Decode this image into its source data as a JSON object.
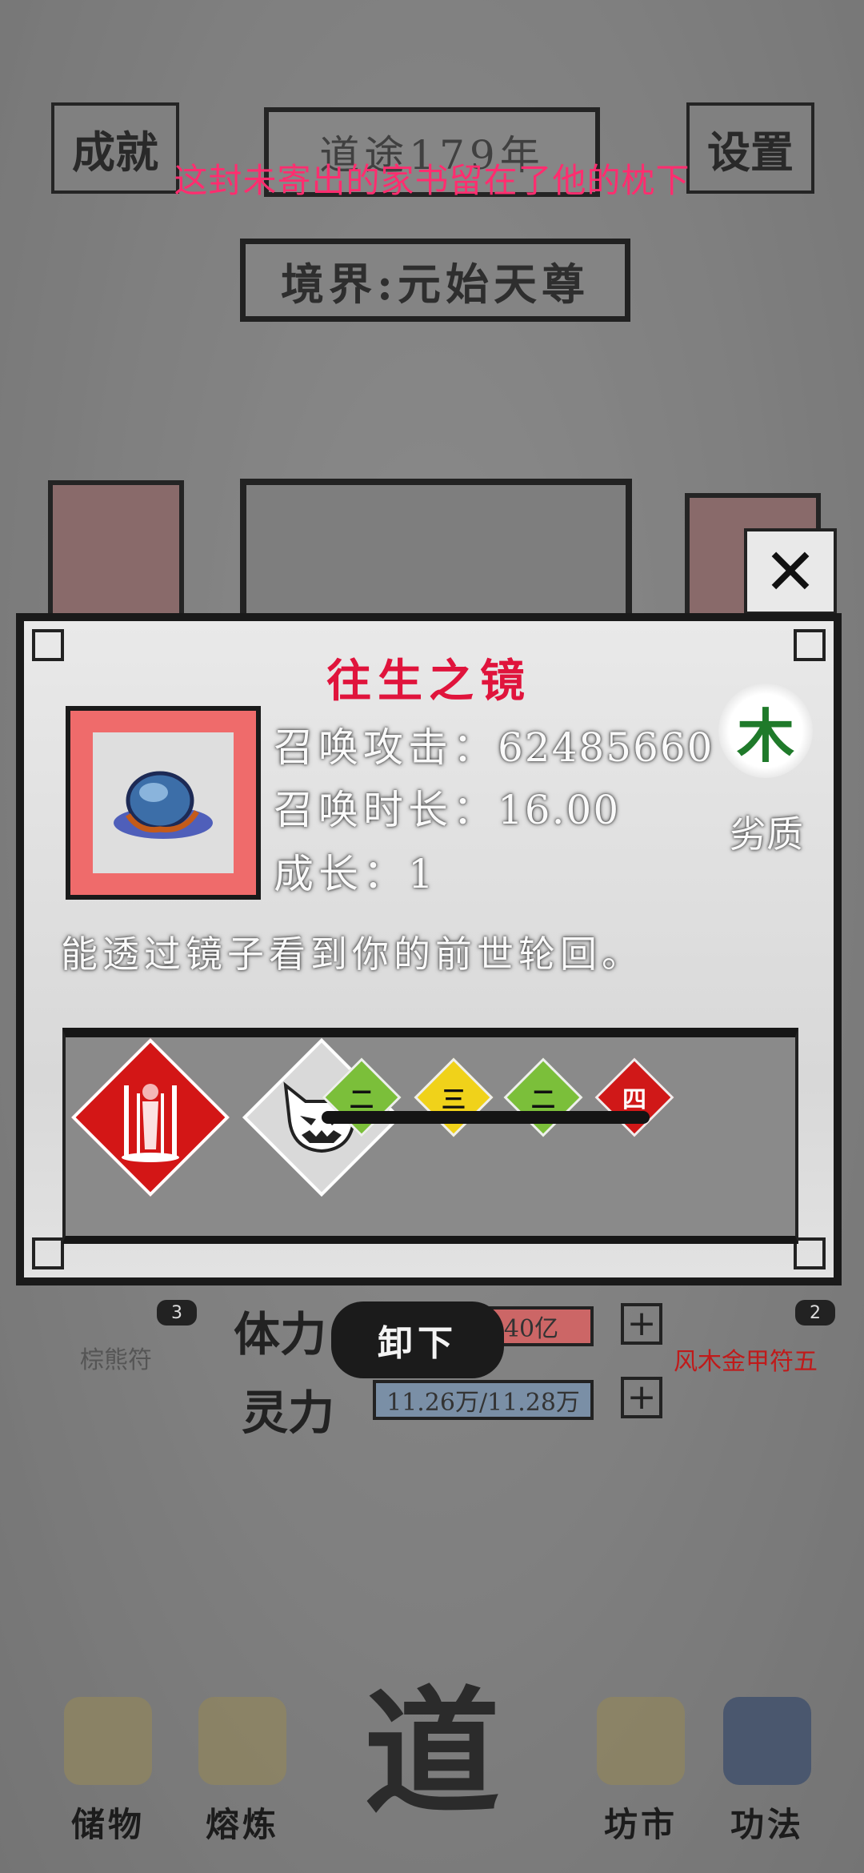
{
  "header": {
    "achievements_label": "成就",
    "years_label": "道途179年",
    "settings_label": "设置",
    "realm_label": "境界:元始天尊"
  },
  "subtitle_overlay": "这封未寄出的家书留在了他的枕下",
  "popup": {
    "close_label": "✕",
    "item_name": "往生之镜",
    "stats": {
      "attack_label": "召唤攻击",
      "attack_value": "62485660",
      "duration_label": "召唤时长",
      "duration_value": "16.00",
      "growth_label": "成长",
      "growth_value": "1"
    },
    "separator": "：",
    "element": "木",
    "quality": "劣质",
    "description": "能透过镜子看到你的前世轮回。",
    "skill_chips": [
      "二",
      "三",
      "二",
      "四"
    ],
    "skill_chip_colors": [
      "#7bbf3a",
      "#f0d21a",
      "#7bbf3a",
      "#d01818"
    ],
    "skill_icon_names": [
      "ghost-summon-icon",
      "demon-face-icon"
    ]
  },
  "lower": {
    "unload_label": "卸下",
    "body_label": "体力",
    "body_value": "40亿",
    "spirit_label": "灵力",
    "spirit_value": "11.26万/11.28万",
    "plus_label": "+",
    "left_card_badge": "3",
    "left_card_name": "棕熊符",
    "right_card_badge": "2",
    "right_card_name": "风木金甲符五"
  },
  "nav": {
    "storage": "储物",
    "refine": "熔炼",
    "center": "道",
    "market": "坊市",
    "skills": "功法"
  }
}
